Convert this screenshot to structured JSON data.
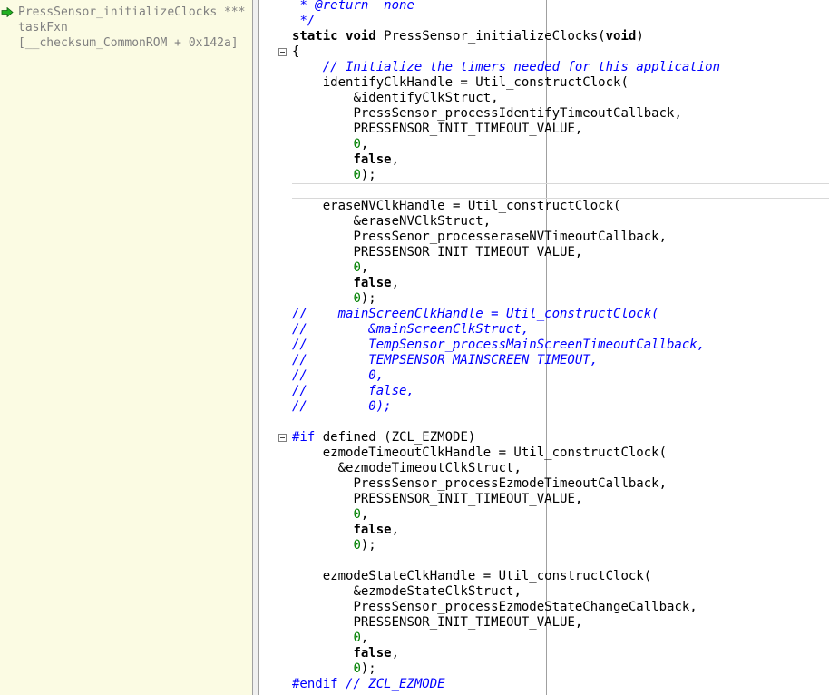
{
  "call_stack": {
    "rows": [
      {
        "text": "PressSensor_initializeClocks ***",
        "current": true
      },
      {
        "text": "taskFxn",
        "current": false
      },
      {
        "text": "[__checksum_CommonROM + 0x142a]",
        "current": false
      }
    ]
  },
  "editor": {
    "lines": [
      {
        "indent": " ",
        "segs": [
          {
            "t": "* @return  none",
            "c": "cm"
          }
        ]
      },
      {
        "indent": " ",
        "segs": [
          {
            "t": "*/",
            "c": "cm"
          }
        ]
      },
      {
        "indent": "",
        "segs": [
          {
            "t": "static",
            "c": "kw"
          },
          {
            "t": " "
          },
          {
            "t": "void",
            "c": "kw"
          },
          {
            "t": " PressSensor_initializeClocks("
          },
          {
            "t": "void",
            "c": "kw"
          },
          {
            "t": ")"
          }
        ]
      },
      {
        "indent": "",
        "fold": true,
        "segs": [
          {
            "t": "{"
          }
        ]
      },
      {
        "indent": "    ",
        "segs": [
          {
            "t": "// Initialize the timers needed for this application",
            "c": "cm"
          }
        ]
      },
      {
        "indent": "    ",
        "segs": [
          {
            "t": "identifyClkHandle = Util_constructClock("
          }
        ]
      },
      {
        "indent": "        ",
        "segs": [
          {
            "t": "&identifyClkStruct,"
          }
        ]
      },
      {
        "indent": "        ",
        "segs": [
          {
            "t": "PressSensor_processIdentifyTimeoutCallback,"
          }
        ]
      },
      {
        "indent": "        ",
        "segs": [
          {
            "t": "PRESSENSOR_INIT_TIMEOUT_VALUE,"
          }
        ]
      },
      {
        "indent": "        ",
        "segs": [
          {
            "t": "0",
            "c": "num"
          },
          {
            "t": ","
          }
        ]
      },
      {
        "indent": "        ",
        "segs": [
          {
            "t": "false",
            "c": "kw"
          },
          {
            "t": ","
          }
        ]
      },
      {
        "indent": "        ",
        "segs": [
          {
            "t": "0",
            "c": "num"
          },
          {
            "t": ");"
          }
        ]
      },
      {
        "indent": "",
        "segs": [],
        "current": true
      },
      {
        "indent": "    ",
        "segs": [
          {
            "t": "eraseNVClkHandle = Util_constructClock("
          }
        ]
      },
      {
        "indent": "        ",
        "segs": [
          {
            "t": "&eraseNVClkStruct,"
          }
        ]
      },
      {
        "indent": "        ",
        "segs": [
          {
            "t": "PressSenor_processeraseNVTimeoutCallback,"
          }
        ]
      },
      {
        "indent": "        ",
        "segs": [
          {
            "t": "PRESSENSOR_INIT_TIMEOUT_VALUE,"
          }
        ]
      },
      {
        "indent": "        ",
        "segs": [
          {
            "t": "0",
            "c": "num"
          },
          {
            "t": ","
          }
        ]
      },
      {
        "indent": "        ",
        "segs": [
          {
            "t": "false",
            "c": "kw"
          },
          {
            "t": ","
          }
        ]
      },
      {
        "indent": "        ",
        "segs": [
          {
            "t": "0",
            "c": "num"
          },
          {
            "t": ");"
          }
        ]
      },
      {
        "indent": "",
        "segs": [
          {
            "t": "//    mainScreenClkHandle = Util_constructClock(",
            "c": "cm"
          }
        ]
      },
      {
        "indent": "",
        "segs": [
          {
            "t": "//        &mainScreenClkStruct,",
            "c": "cm"
          }
        ]
      },
      {
        "indent": "",
        "segs": [
          {
            "t": "//        TempSensor_processMainScreenTimeoutCallback,",
            "c": "cm"
          }
        ]
      },
      {
        "indent": "",
        "segs": [
          {
            "t": "//        TEMPSENSOR_MAINSCREEN_TIMEOUT,",
            "c": "cm"
          }
        ]
      },
      {
        "indent": "",
        "segs": [
          {
            "t": "//        0,",
            "c": "cm"
          }
        ]
      },
      {
        "indent": "",
        "segs": [
          {
            "t": "//        false,",
            "c": "cm"
          }
        ]
      },
      {
        "indent": "",
        "segs": [
          {
            "t": "//        0);",
            "c": "cm"
          }
        ]
      },
      {
        "indent": "",
        "segs": []
      },
      {
        "indent": "",
        "fold": true,
        "segs": [
          {
            "t": "#if",
            "c": "pp"
          },
          {
            "t": " defined (ZCL_EZMODE)"
          }
        ]
      },
      {
        "indent": "    ",
        "segs": [
          {
            "t": "ezmodeTimeoutClkHandle = Util_constructClock("
          }
        ]
      },
      {
        "indent": "      ",
        "segs": [
          {
            "t": "&ezmodeTimeoutClkStruct,"
          }
        ]
      },
      {
        "indent": "        ",
        "segs": [
          {
            "t": "PressSensor_processEzmodeTimeoutCallback,"
          }
        ]
      },
      {
        "indent": "        ",
        "segs": [
          {
            "t": "PRESSENSOR_INIT_TIMEOUT_VALUE,"
          }
        ]
      },
      {
        "indent": "        ",
        "segs": [
          {
            "t": "0",
            "c": "num"
          },
          {
            "t": ","
          }
        ]
      },
      {
        "indent": "        ",
        "segs": [
          {
            "t": "false",
            "c": "kw"
          },
          {
            "t": ","
          }
        ]
      },
      {
        "indent": "        ",
        "segs": [
          {
            "t": "0",
            "c": "num"
          },
          {
            "t": ");"
          }
        ]
      },
      {
        "indent": "",
        "segs": []
      },
      {
        "indent": "    ",
        "segs": [
          {
            "t": "ezmodeStateClkHandle = Util_constructClock("
          }
        ]
      },
      {
        "indent": "        ",
        "segs": [
          {
            "t": "&ezmodeStateClkStruct,"
          }
        ]
      },
      {
        "indent": "        ",
        "segs": [
          {
            "t": "PressSensor_processEzmodeStateChangeCallback,"
          }
        ]
      },
      {
        "indent": "        ",
        "segs": [
          {
            "t": "PRESSENSOR_INIT_TIMEOUT_VALUE,"
          }
        ]
      },
      {
        "indent": "        ",
        "segs": [
          {
            "t": "0",
            "c": "num"
          },
          {
            "t": ","
          }
        ]
      },
      {
        "indent": "        ",
        "segs": [
          {
            "t": "false",
            "c": "kw"
          },
          {
            "t": ","
          }
        ]
      },
      {
        "indent": "        ",
        "segs": [
          {
            "t": "0",
            "c": "num"
          },
          {
            "t": ");"
          }
        ]
      },
      {
        "indent": "",
        "segs": [
          {
            "t": "#endif",
            "c": "pp"
          },
          {
            "t": " "
          },
          {
            "t": "// ZCL_EZMODE",
            "c": "cm"
          }
        ]
      }
    ]
  }
}
